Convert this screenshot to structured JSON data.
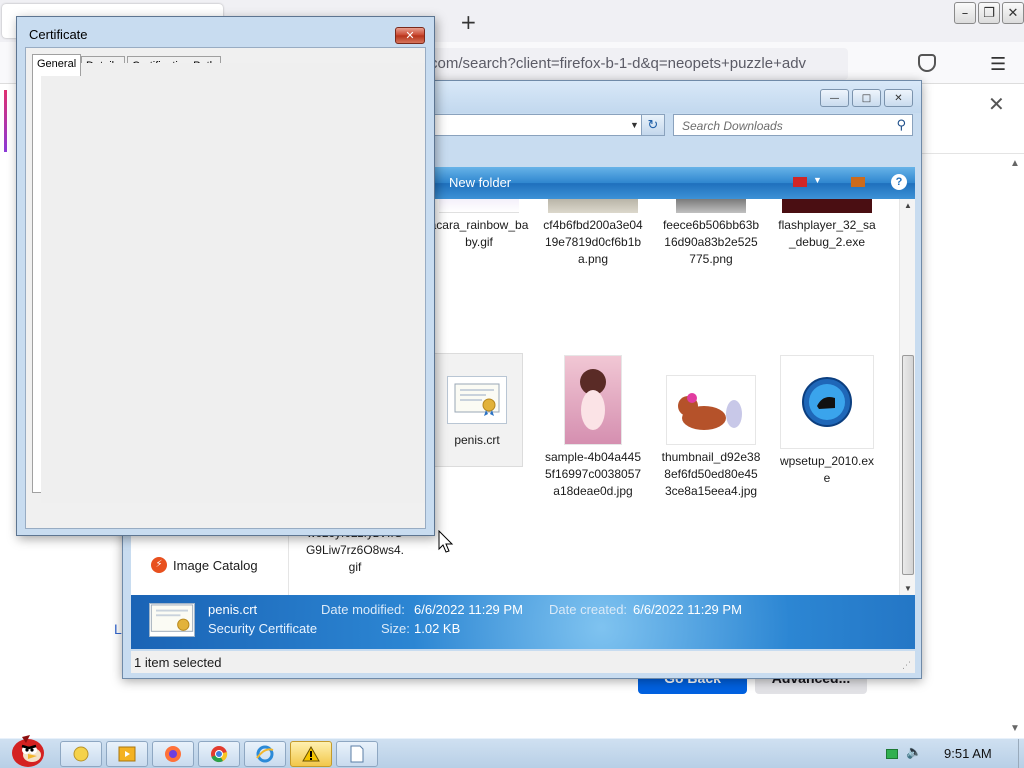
{
  "firefox": {
    "new_tab_icon": "plus-icon",
    "url_visible_text": "com/search?client=firefox-b-1-d&q=neopets+puzzle+adv",
    "star_icon": "star-icon",
    "link_fragment": "L",
    "go_back_label": "Go Back",
    "advanced_label": "Advanced..."
  },
  "downloads": {
    "search_placeholder": "Search Downloads",
    "toolbar_new_folder": "New folder",
    "nav_catalog_label": "Image Catalog",
    "files": [
      {
        "name": "acara_rainbow_baby.gif"
      },
      {
        "name": "cf4b6fbd200a3e0419e7819d0cf6b1ba.png"
      },
      {
        "name": "feece6b506bb63b16d90a83b2e525775.png"
      },
      {
        "name": "flashplayer_32_sa_debug_2.exe"
      },
      {
        "name": "penis.crt"
      },
      {
        "name": "sample-4b04a4455f16997c0038057a18deae0d.jpg"
      },
      {
        "name": "thumbnail_d92e388ef6fd50ed80e453ce8a15eea4.jpg"
      },
      {
        "name": "wpsetup_2010.exe"
      },
      {
        "name": "wcL6yf02zfyzVIIGG9Liw7rz6O8ws4.gif"
      }
    ],
    "details": {
      "name": "penis.crt",
      "type": "Security Certificate",
      "date_modified_label": "Date modified:",
      "date_modified": "6/6/2022 11:29 PM",
      "date_created_label": "Date created:",
      "date_created": "6/6/2022 11:29 PM",
      "size_label": "Size:",
      "size": "1.02 KB"
    },
    "status": "1 item selected"
  },
  "certificate": {
    "title": "Certificate",
    "tabs": [
      "General",
      "Details",
      "Certification Path"
    ],
    "partial_label": "Le"
  },
  "taskbar": {
    "clock": "9:51 AM",
    "apps": [
      "folder-icon",
      "media-player-icon",
      "firefox-icon",
      "chrome-icon",
      "internet-explorer-icon",
      "warning-icon",
      "document-icon"
    ]
  }
}
